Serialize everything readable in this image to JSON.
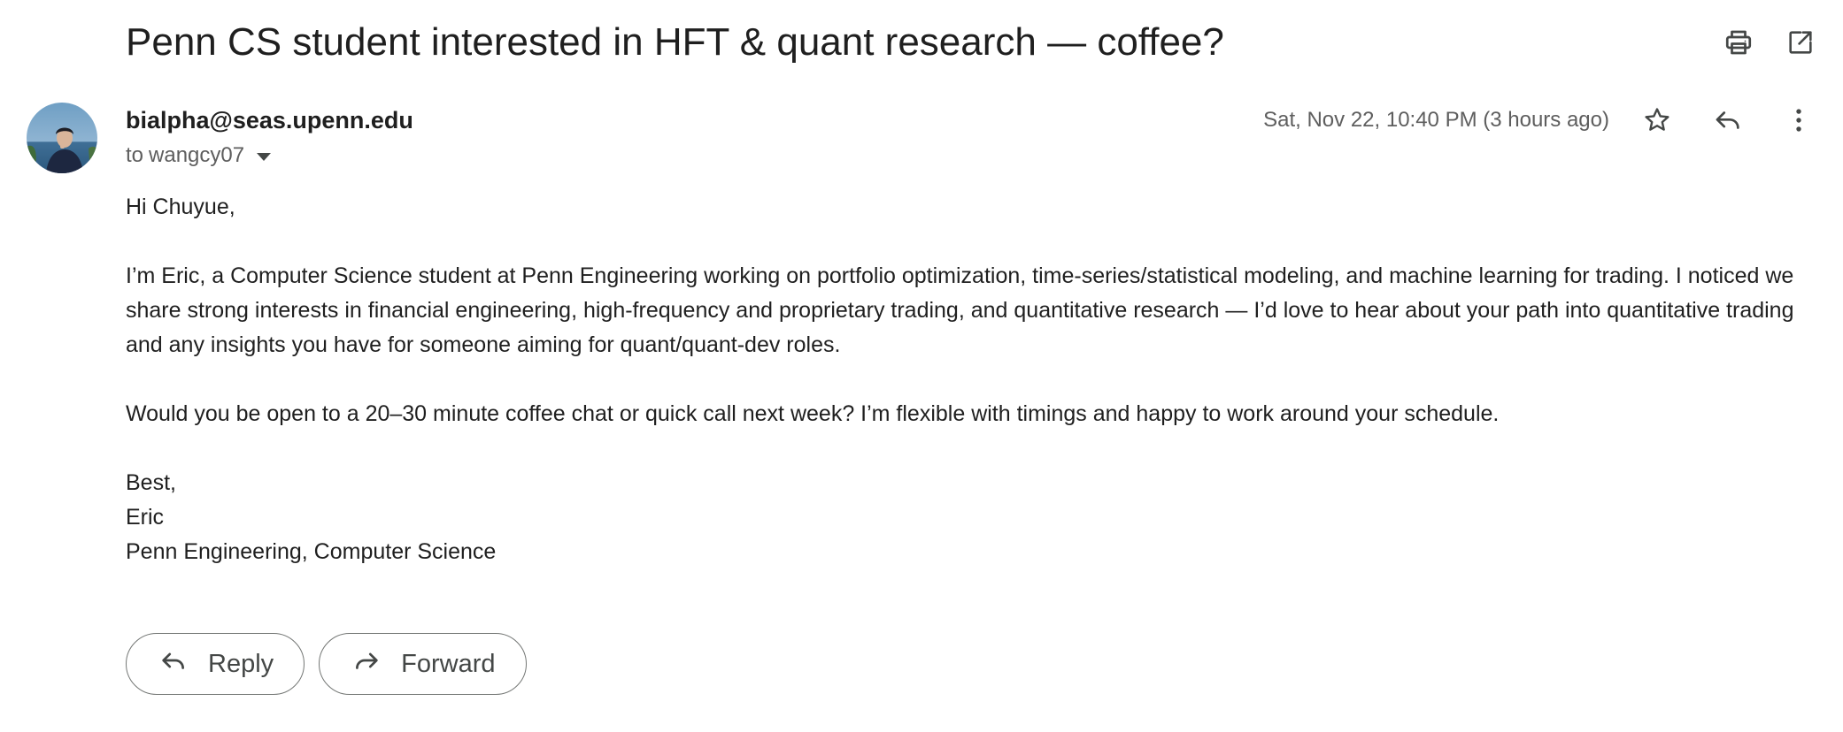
{
  "email": {
    "subject": "Penn CS student interested in HFT & quant research — coffee?",
    "sender": "bialpha@seas.upenn.edu",
    "recipient_prefix": "to",
    "recipient": "wangcy07",
    "timestamp": "Sat, Nov 22, 10:40 PM (3 hours ago)",
    "body": {
      "greeting": "Hi Chuyue,",
      "paragraph1": "I’m Eric, a Computer Science student at Penn Engineering working on portfolio optimization, time-series/statistical modeling, and machine learning for trading. I noticed we share strong interests in financial engineering, high-frequency and proprietary trading, and quantitative research — I’d love to hear about your path into quantitative trading and any insights you have for someone aiming for quant/quant-dev roles.",
      "paragraph2": "Would you be open to a 20–30 minute coffee chat or quick call next week? I’m flexible with timings and happy to work around your schedule.",
      "signoff": "Best,",
      "signature_name": "Eric",
      "signature_title": "Penn Engineering, Computer Science"
    }
  },
  "actions": {
    "reply_label": "Reply",
    "forward_label": "Forward"
  },
  "icons": {
    "print": "print-icon",
    "open_new_window": "open-in-new-window-icon",
    "star": "star-icon",
    "reply": "reply-icon",
    "more": "more-vert-icon",
    "recipient_details": "caret-down-icon",
    "forward": "forward-icon"
  },
  "colors": {
    "text_primary": "#1f1f1f",
    "text_secondary": "#5e5e5e",
    "icon": "#444746",
    "pill_border": "#747775"
  }
}
